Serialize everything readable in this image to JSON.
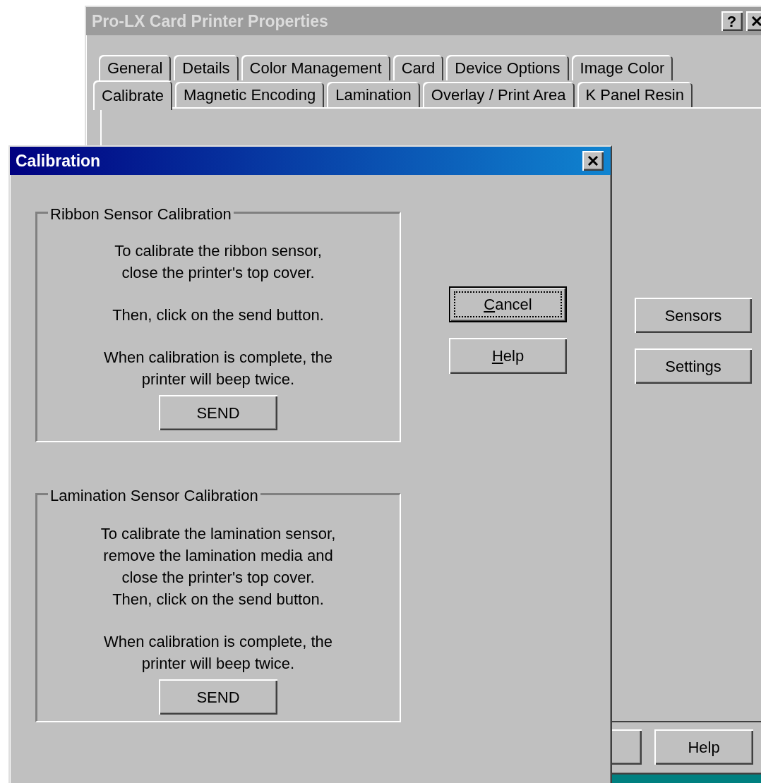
{
  "back_window": {
    "title": "Pro-LX Card Printer Properties",
    "help_button": "?",
    "tab_rows": [
      [
        {
          "label": "General",
          "selected": false
        },
        {
          "label": "Details",
          "selected": false
        },
        {
          "label": "Color Management",
          "selected": false
        },
        {
          "label": "Card",
          "selected": false
        },
        {
          "label": "Device Options",
          "selected": false
        },
        {
          "label": "Image Color",
          "selected": false
        }
      ],
      [
        {
          "label": "Calibrate",
          "selected": true
        },
        {
          "label": "Magnetic Encoding",
          "selected": false
        },
        {
          "label": "Lamination",
          "selected": false
        },
        {
          "label": "Overlay / Print Area",
          "selected": false
        },
        {
          "label": "K Panel Resin",
          "selected": false
        }
      ]
    ],
    "panel_buttons": [
      "Sensors",
      "Settings"
    ],
    "footer_buttons": [
      {
        "kind": "partial"
      },
      {
        "kind": "text",
        "label": "Help"
      }
    ]
  },
  "dialog": {
    "title": "Calibration",
    "groups": [
      {
        "legend": "Ribbon Sensor Calibration",
        "paragraphs": [
          "To calibrate the ribbon sensor,\nclose the printer's top cover.",
          "Then, click on the send button.",
          "When calibration is complete, the\nprinter will beep twice."
        ],
        "button": "SEND"
      },
      {
        "legend": "Lamination Sensor Calibration",
        "paragraphs": [
          "To calibrate the lamination sensor,\nremove the lamination media and\nclose the printer's top cover.\nThen, click on the send button.",
          "When calibration is complete, the\nprinter will beep twice."
        ],
        "button": "SEND"
      }
    ],
    "buttons": [
      {
        "label": "Cancel",
        "focused": true,
        "mnemonic": true
      },
      {
        "label": "Help",
        "focused": false,
        "mnemonic": true
      }
    ]
  }
}
